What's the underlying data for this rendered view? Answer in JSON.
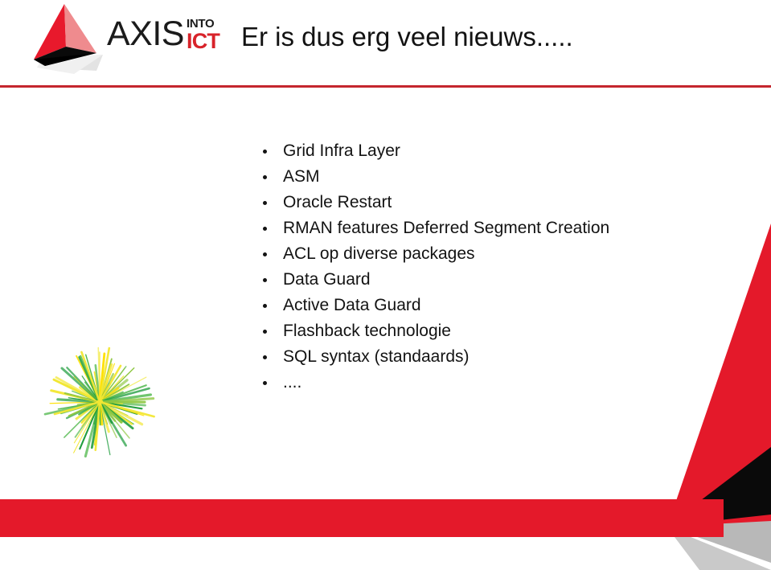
{
  "slide": {
    "title": "Er is dus erg veel nieuws.....",
    "background_color": "#ffffff"
  },
  "logo": {
    "mark_name": "axis-pyramid-logo",
    "wordmark_primary": "AXIS",
    "wordmark_super": "INTO",
    "wordmark_accent": "ICT",
    "colors": {
      "red": "#e4192a",
      "red_dark": "#c4262e",
      "red_light": "#ef8b8e",
      "black": "#000000",
      "shadow_grey": "#d9d9d9"
    }
  },
  "bullets": [
    {
      "text": "Grid Infra Layer"
    },
    {
      "text": "ASM"
    },
    {
      "text": "Oracle Restart"
    },
    {
      "text": "RMAN features Deferred Segment Creation"
    },
    {
      "text": "ACL  op diverse packages"
    },
    {
      "text": "Data Guard"
    },
    {
      "text": "Active Data Guard"
    },
    {
      "text": "Flashback technologie"
    },
    {
      "text": "SQL syntax  (standaards)"
    },
    {
      "text": "...."
    }
  ],
  "decor": {
    "header_rule_color": "#c4262e",
    "bottom_band_color": "#e4192a",
    "corner_red": "#e4192a",
    "corner_black": "#0a0a0a",
    "corner_grey": "#b8b8b8",
    "starburst_name": "green-yellow-firework-burst",
    "starburst_colors": [
      "#4cb648",
      "#8cc63f",
      "#f2e733",
      "#1e9c3c",
      "#ffe000"
    ]
  }
}
